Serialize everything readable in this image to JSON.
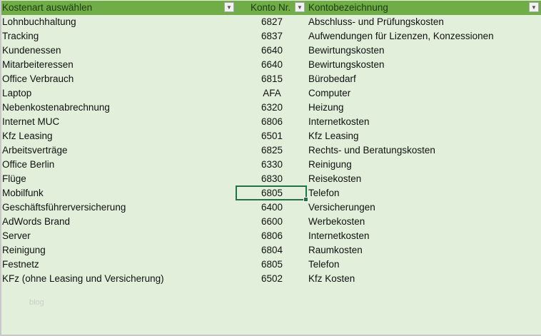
{
  "header": {
    "col1": "Kostenart auswählen",
    "col2": "Konto Nr.",
    "col3": "Kontobezeichnung",
    "filter_icon": "▼"
  },
  "rows": [
    {
      "kostenart": "Lohnbuchhaltung",
      "konto": "6827",
      "bezeichnung": "Abschluss- und Prüfungskosten"
    },
    {
      "kostenart": "Tracking",
      "konto": "6837",
      "bezeichnung": "Aufwendungen für Lizenzen, Konzessionen"
    },
    {
      "kostenart": "Kundenessen",
      "konto": "6640",
      "bezeichnung": "Bewirtungskosten"
    },
    {
      "kostenart": "Mitarbeiteressen",
      "konto": "6640",
      "bezeichnung": "Bewirtungskosten"
    },
    {
      "kostenart": "Office Verbrauch",
      "konto": "6815",
      "bezeichnung": "Bürobedarf"
    },
    {
      "kostenart": "Laptop",
      "konto": "AFA",
      "bezeichnung": "Computer"
    },
    {
      "kostenart": "Nebenkostenabrechnung",
      "konto": "6320",
      "bezeichnung": "Heizung"
    },
    {
      "kostenart": "Internet MUC",
      "konto": "6806",
      "bezeichnung": "Internetkosten"
    },
    {
      "kostenart": "Kfz Leasing",
      "konto": "6501",
      "bezeichnung": "Kfz Leasing"
    },
    {
      "kostenart": "Arbeitsverträge",
      "konto": "6825",
      "bezeichnung": "Rechts- und Beratungskosten"
    },
    {
      "kostenart": "Office Berlin",
      "konto": "6330",
      "bezeichnung": "Reinigung"
    },
    {
      "kostenart": "Flüge",
      "konto": "6830",
      "bezeichnung": "Reisekosten"
    },
    {
      "kostenart": "Mobilfunk",
      "konto": "6805",
      "bezeichnung": "Telefon"
    },
    {
      "kostenart": "Geschäftsführerversicherung",
      "konto": "6400",
      "bezeichnung": "Versicherungen"
    },
    {
      "kostenart": "AdWords Brand",
      "konto": "6600",
      "bezeichnung": "Werbekosten"
    },
    {
      "kostenart": "Server",
      "konto": "6806",
      "bezeichnung": "Internetkosten"
    },
    {
      "kostenart": "Reinigung",
      "konto": "6804",
      "bezeichnung": "Raumkosten"
    },
    {
      "kostenart": "Festnetz",
      "konto": "6805",
      "bezeichnung": "Telefon"
    },
    {
      "kostenart": "KFz (ohne Leasing und Versicherung)",
      "konto": "6502",
      "bezeichnung": "Kfz Kosten"
    }
  ],
  "watermark": "blog"
}
